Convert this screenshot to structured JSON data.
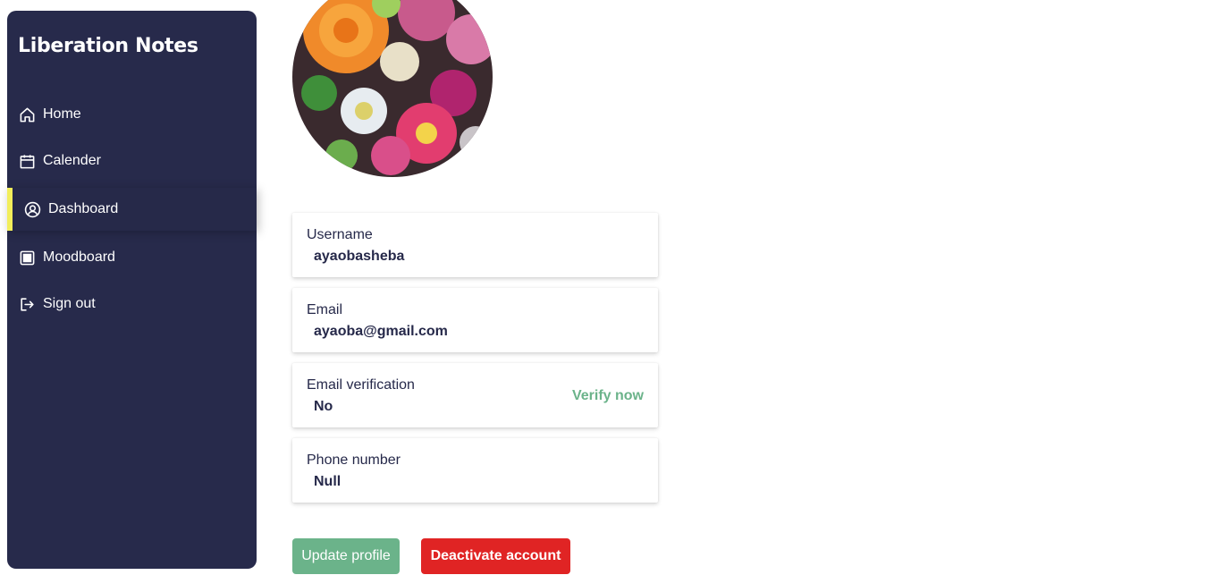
{
  "app": {
    "title": "Liberation Notes"
  },
  "sidebar": {
    "items": [
      {
        "label": "Home",
        "icon": "home-icon"
      },
      {
        "label": "Calender",
        "icon": "calendar-icon"
      },
      {
        "label": "Dashboard",
        "icon": "user-circle-icon",
        "active": true
      },
      {
        "label": "Moodboard",
        "icon": "moodboard-icon"
      },
      {
        "label": "Sign out",
        "icon": "sign-out-icon"
      }
    ]
  },
  "profile": {
    "avatar": "flower-photo",
    "fields": [
      {
        "label": "Username",
        "value": "ayaobasheba"
      },
      {
        "label": "Email",
        "value": "ayaoba@gmail.com"
      },
      {
        "label": "Email verification",
        "value": "No",
        "action": "Verify now"
      },
      {
        "label": "Phone number",
        "value": "Null"
      }
    ]
  },
  "actions": {
    "update_label": "Update profile",
    "deactivate_label": "Deactivate account"
  },
  "colors": {
    "sidebar_bg": "#272a4b",
    "active_indicator": "#f2ee5a",
    "accent_green": "#6bb38a",
    "danger_red": "#e02424"
  }
}
